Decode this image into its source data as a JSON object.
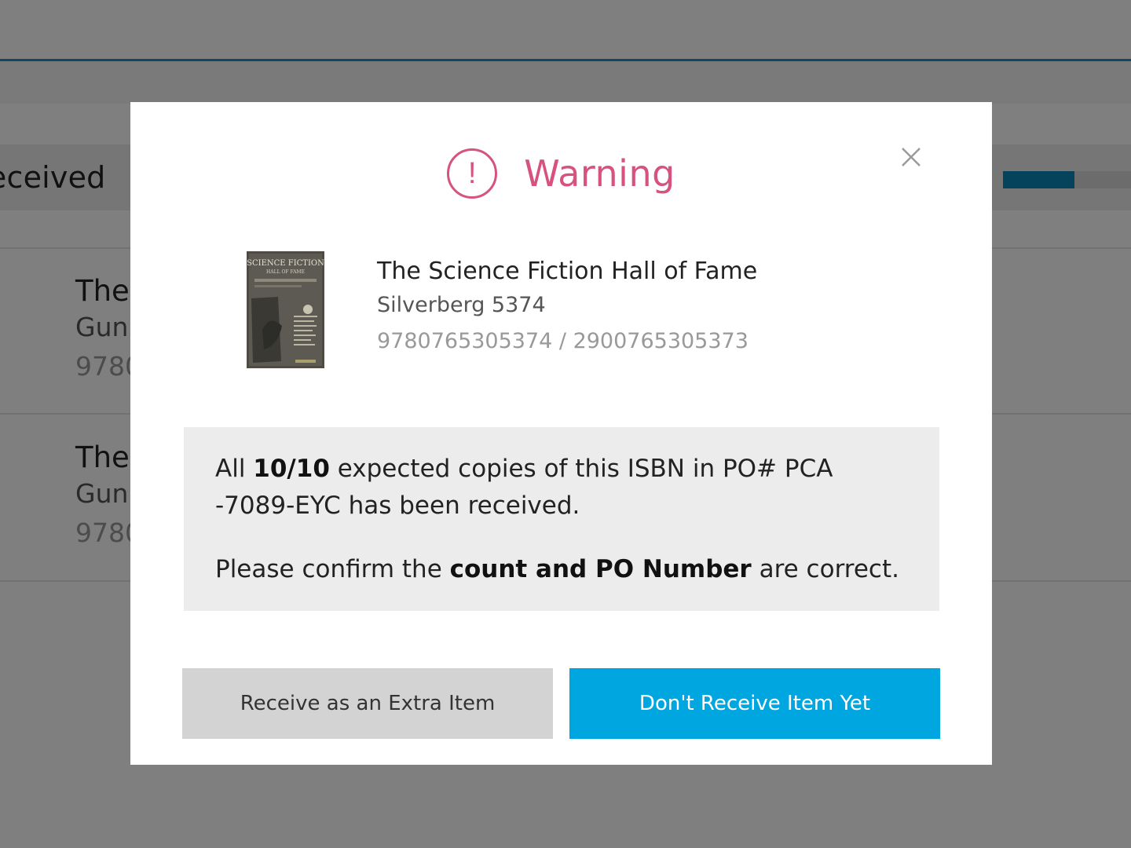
{
  "background": {
    "section_label": "Received",
    "progress_fraction": 0.56,
    "rows": [
      {
        "title": "The",
        "author": "Gun",
        "isbn": "9780"
      },
      {
        "title": "The",
        "author": "Gun",
        "isbn": "9780"
      }
    ]
  },
  "modal": {
    "icon": "exclamation-circle-icon",
    "title": "Warning",
    "close_icon": "close-icon",
    "book": {
      "cover_title": "SCIENCE FICTION",
      "cover_subtitle": "HALL OF FAME",
      "title": "The Science Fiction Hall of Fame",
      "author": "Silverberg 5374",
      "isbn": "9780765305374 / 2900765305373"
    },
    "message": {
      "line1_prefix": "All ",
      "count": "10/10",
      "line1_suffix": " expected copies of this ISBN in PO# PCA -7089-EYC has been received.",
      "line2_prefix": "Please confirm the ",
      "line2_bold": "count and PO Number",
      "line2_suffix": " are correct."
    },
    "buttons": {
      "secondary": "Receive as an Extra Item",
      "primary": "Don't Receive Item Yet"
    }
  },
  "colors": {
    "warning": "#d6527f",
    "primary_button": "#00a6df",
    "secondary_button": "#d3d3d3",
    "accent_line": "#1a8fc4"
  }
}
